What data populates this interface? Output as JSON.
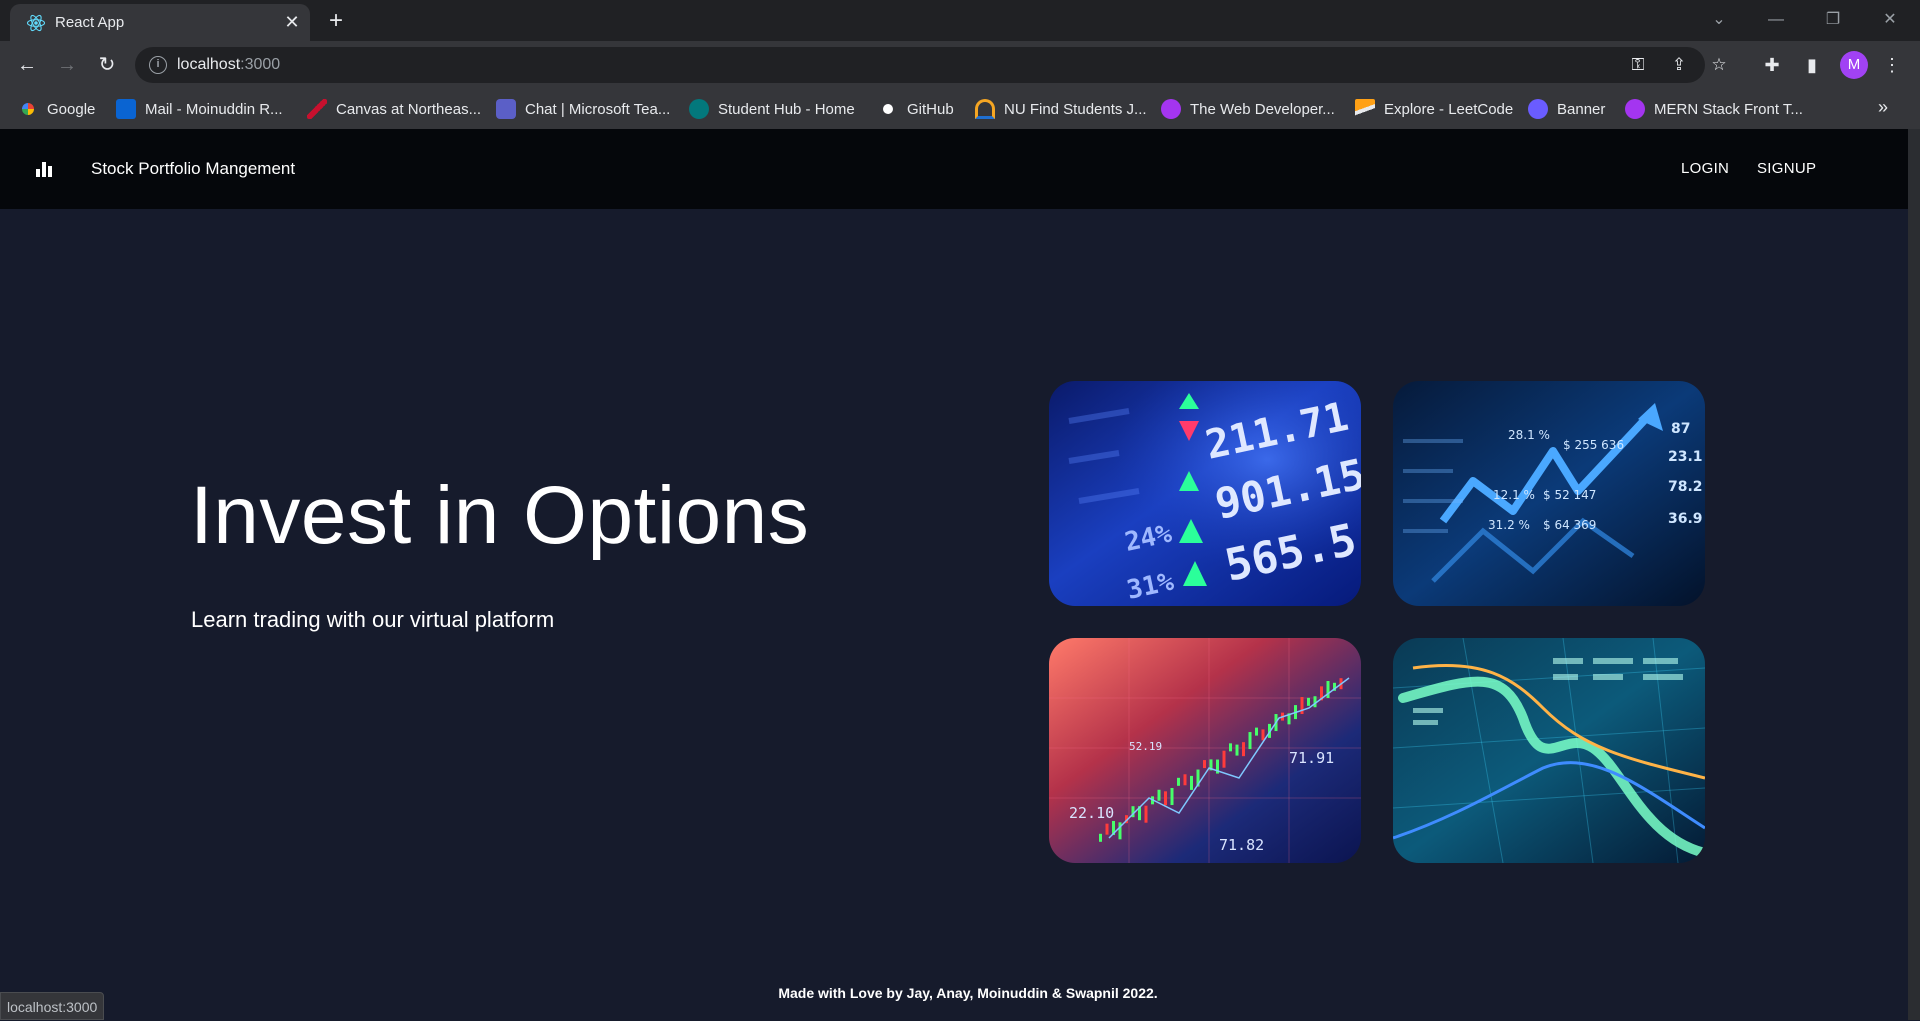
{
  "browser": {
    "tab_title": "React App",
    "url_host": "localhost",
    "url_port": ":3000",
    "avatar_letter": "M",
    "bookmarks": [
      {
        "label": "Google",
        "icon": "google-icon",
        "color": "#4285f4"
      },
      {
        "label": "Mail - Moinuddin R...",
        "icon": "outlook-icon",
        "color": "#0a64d2"
      },
      {
        "label": "Canvas at Northeas...",
        "icon": "northeastern-icon",
        "color": "#c8102e"
      },
      {
        "label": "Chat | Microsoft Tea...",
        "icon": "teams-icon",
        "color": "#5b5fc7"
      },
      {
        "label": "Student Hub - Home",
        "icon": "sharepoint-icon",
        "color": "#03787c"
      },
      {
        "label": "GitHub",
        "icon": "github-icon",
        "color": "#ffffff"
      },
      {
        "label": "NU Find Students J...",
        "icon": "workday-icon",
        "color": "#f5a623"
      },
      {
        "label": "The Web Developer...",
        "icon": "udemy-icon",
        "color": "#a435f0"
      },
      {
        "label": "Explore - LeetCode",
        "icon": "leetcode-icon",
        "color": "#ffa116"
      },
      {
        "label": "Banner",
        "icon": "banner-icon",
        "color": "#6a5cff"
      },
      {
        "label": "MERN Stack Front T...",
        "icon": "udemy-icon",
        "color": "#a435f0"
      }
    ]
  },
  "appbar": {
    "title": "Stock Portfolio Mangement",
    "login": "LOGIN",
    "signup": "SIGNUP"
  },
  "hero": {
    "title": "Invest in Options",
    "subtitle": "Learn trading with our virtual platform"
  },
  "tiles": {
    "ticker_numbers": [
      "211.71",
      "901.15",
      "565.5",
      "24%",
      "31%"
    ],
    "arrow_stats": [
      "28.1 %",
      "$ 255 636",
      "$ 52 147",
      "$ 64 369",
      "12.1 %",
      "31.2 %",
      "78.2",
      "36.9",
      "23.1",
      "87"
    ],
    "candle_labels": [
      "22.10",
      "71.82",
      "71.91",
      "52.19"
    ]
  },
  "footer": {
    "credit": "Made with Love by Jay, Anay, Moinuddin & Swapnil 2022."
  },
  "status_bar": {
    "text": "localhost:3000"
  }
}
